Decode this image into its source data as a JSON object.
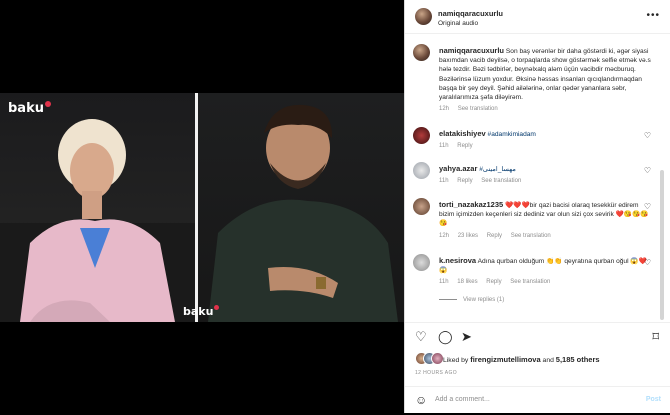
{
  "video": {
    "brand_left": "baku",
    "brand_bottom": "baku"
  },
  "post": {
    "author": "namiqqaracuxurlu",
    "audio": "Original audio",
    "caption_author": "namiqqaracuxurlu",
    "caption": "Son baş verənlər bir daha göstərdi ki, əgər siyasi baxımdan vacib deyilsə, o torpaqlarda show göstərmək selfie etmək və.s hələ tezdir. Bəzi tədbirlər, beynəlxalq aləm üçün vacibdir məcburuq. Bəzilərinsə lüzum yoxdur. Əksinə həssas insanları qıcıqlandırmaqdan başqa bir şey deyil. Şəhid ailələrinə, onlar qədər yananlara səbr, yaralılarımıza şəfa diləyirəm.",
    "caption_time": "12h",
    "caption_translation": "See translation"
  },
  "comments": [
    {
      "user": "elatakishiyev",
      "text": "#adamkimiadam",
      "time": "11h",
      "reply": "Reply"
    },
    {
      "user": "yahya.azar",
      "text": "#مهسا_امینی",
      "time": "11h",
      "reply": "Reply",
      "translation": "See translation"
    },
    {
      "user": "torti_nazakaz1235",
      "text": "❤️❤️❤️bir qazi bacisi olaraq tesekkür edirem bizim içimizden keçenleri siz dediniz var olun sizi çox sevirik ❤️😘😘😘😘",
      "time": "12h",
      "likes": "23 likes",
      "reply": "Reply",
      "translation": "See translation"
    },
    {
      "user": "k.nesirova",
      "text": "Adına qurban olduğum 👏👏 qeyratına qurban oğul 😱❤️😱",
      "time": "11h",
      "likes": "18 likes",
      "reply": "Reply",
      "translation": "See translation"
    }
  ],
  "view_replies": "View replies (1)",
  "likes": {
    "prefix": "Liked by",
    "user": "firengizmutellimova",
    "and": "and",
    "others": "5,185 others"
  },
  "time_ago": "12 HOURS AGO",
  "add_comment": {
    "placeholder": "Add a comment...",
    "post_label": "Post"
  }
}
